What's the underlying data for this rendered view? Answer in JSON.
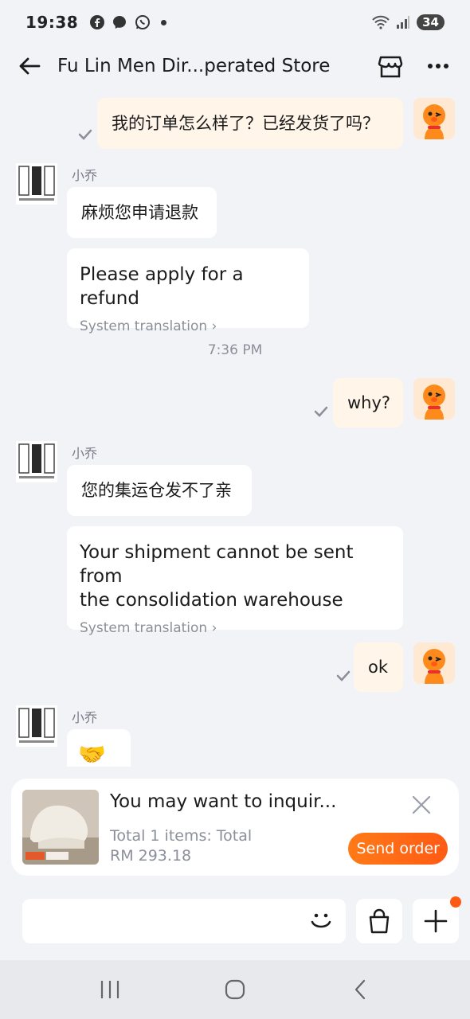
{
  "status_bar": {
    "time": "19:38",
    "battery": "34"
  },
  "header": {
    "title": "Fu Lin Men Dir...perated Store"
  },
  "messages": {
    "m1": {
      "text": "我的订单怎么样了？已经发货了吗？"
    },
    "m2": {
      "sender": "小乔",
      "text": "麻烦您申请退款",
      "translation": "Please apply for a refund",
      "translation_link": "System translation ›"
    },
    "timestamp": "7:36 PM",
    "m3": {
      "text": "why?"
    },
    "m4": {
      "sender": "小乔",
      "text": "您的集运仓发不了亲",
      "translation_line1": "Your shipment cannot be sent from",
      "translation_line2": "the consolidation warehouse",
      "translation_link": "System translation ›"
    },
    "m5": {
      "text": "ok"
    },
    "m6": {
      "sender": "小乔",
      "text": "🤝"
    }
  },
  "order_card": {
    "title": "You may want to inquir...",
    "line1": "Total 1 items: Total",
    "line2": "RM 293.18",
    "send_label": "Send order"
  },
  "input": {
    "placeholder": ""
  },
  "colors": {
    "accent": "#ff5a14",
    "my_bubble": "#fff5e9",
    "background": "#f2f3f7"
  },
  "icons": [
    "facebook-icon",
    "messenger-icon",
    "whatsapp-icon",
    "wifi-icon",
    "signal-icon",
    "back-arrow-icon",
    "store-icon",
    "more-icon",
    "check-icon",
    "close-icon",
    "smiley-icon",
    "bag-icon",
    "plus-icon",
    "recents-icon",
    "home-icon",
    "back-nav-icon"
  ]
}
